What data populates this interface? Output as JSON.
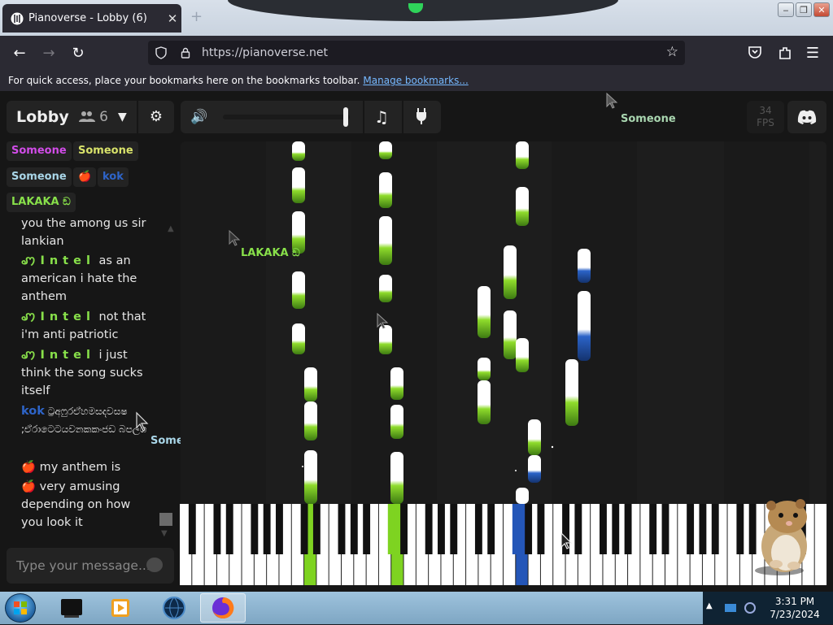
{
  "browser": {
    "tab_title": "Pianoverse - Lobby (6)",
    "tab_close": "✕",
    "new_tab": "+",
    "url": "https://pianoverse.net",
    "bookmark_hint": "For quick access, place your bookmarks here on the bookmarks toolbar.",
    "bookmark_link": "Manage bookmarks..."
  },
  "room": {
    "name": "Lobby",
    "user_count": "6",
    "fps_value": "34",
    "fps_label": "FPS"
  },
  "volume_level": 0.97,
  "users": [
    {
      "name": "Someone",
      "color": "#d14ce8"
    },
    {
      "name": "Someone",
      "color": "#d8e26a"
    },
    {
      "name": "Someone",
      "color": "#a9d6e8"
    },
    {
      "name": "🍎",
      "color": "#e23b2e"
    },
    {
      "name": "kok",
      "color": "#2e64c8"
    },
    {
      "name": "LAKAKA ඞ",
      "color": "#88e04a"
    }
  ],
  "chat": {
    "messages": [
      {
        "nick": "",
        "text": "you the among us sir lankian",
        "nick_color": ""
      },
      {
        "nick": "ꩇIntel",
        "text": "as an american i hate the anthem",
        "nick_color": "#88e04a"
      },
      {
        "nick": "ꩇIntel",
        "text": "not that i'm anti patriotic",
        "nick_color": "#88e04a"
      },
      {
        "nick": "ꩇIntel",
        "text": "i just think the song sucks itself",
        "nick_color": "#88e04a"
      },
      {
        "nick": "kok",
        "text": "ට්‍රඅෆුරඒහමසදවසෂ ;ඒරාටෙටයවනකකංජඩ බපලග",
        "nick_color": "#2e64c8"
      },
      {
        "nick": "🍎",
        "text": "my anthem is",
        "nick_color": "#e23b2e"
      },
      {
        "nick": "🍎",
        "text": "very amusing depending on how you look it",
        "nick_color": "#e23b2e"
      }
    ],
    "input_placeholder": "Type your message..."
  },
  "cursors": [
    {
      "label": "Someone",
      "color": "#a9d6b0"
    },
    {
      "label": "LAKAKA ඞ",
      "color": "#88e04a"
    },
    {
      "label": "Someone",
      "color": "#a9d6e8"
    }
  ],
  "taskbar": {
    "time": "3:31 PM",
    "date": "7/23/2024"
  },
  "colors": {
    "green_note": "#7ed321",
    "blue_note": "#2456b8",
    "accent": "#75b8ff"
  }
}
